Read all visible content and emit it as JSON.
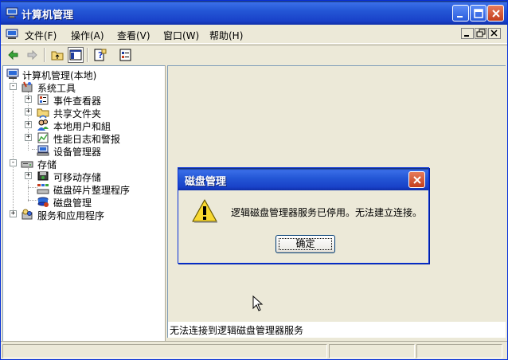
{
  "window": {
    "title": "计算机管理",
    "icon": "computer-management-icon"
  },
  "menubar": {
    "items": [
      {
        "label": "文件(F)"
      },
      {
        "label": "操作(A)"
      },
      {
        "label": "查看(V)"
      },
      {
        "label": "窗口(W)"
      },
      {
        "label": "帮助(H)"
      }
    ]
  },
  "toolbar": {
    "icons": [
      "back-arrow-icon",
      "forward-arrow-icon",
      "up-folder-icon",
      "show-hide-tree-icon",
      "help-icon",
      "properties-icon"
    ]
  },
  "tree": {
    "root": "计算机管理(本地)",
    "nodes": [
      {
        "label": "系统工具",
        "expander": "-"
      },
      {
        "label": "事件查看器",
        "expander": "+"
      },
      {
        "label": "共享文件夹",
        "expander": "+"
      },
      {
        "label": "本地用户和組",
        "expander": "+"
      },
      {
        "label": "性能日志和警报",
        "expander": "+"
      },
      {
        "label": "设备管理器",
        "expander": ""
      },
      {
        "label": "存储",
        "expander": "-"
      },
      {
        "label": "可移动存储",
        "expander": "+"
      },
      {
        "label": "磁盘碎片整理程序",
        "expander": ""
      },
      {
        "label": "磁盘管理",
        "expander": ""
      },
      {
        "label": "服务和应用程序",
        "expander": "+"
      }
    ]
  },
  "right_pane": {
    "info_text": "无法连接到逻辑磁盘管理器服务"
  },
  "dialog": {
    "title": "磁盘管理",
    "message": "逻辑磁盘管理器服务已停用。无法建立连接。",
    "ok_label": "确定",
    "icon": "warning-icon"
  },
  "colors": {
    "titlebar": "#2457D6",
    "close_button": "#C43E1C",
    "window_bg": "#ECE9D8"
  }
}
